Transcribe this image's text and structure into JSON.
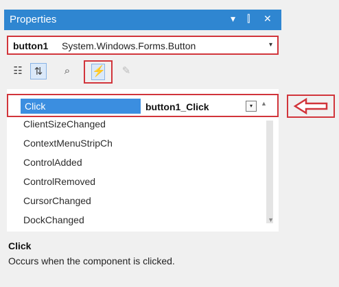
{
  "window": {
    "title": "Properties",
    "buttons": [
      "▾",
      "⫿",
      "✕"
    ]
  },
  "selector": {
    "name": "button1",
    "type": "System.Windows.Forms.Button",
    "arrow": "▾"
  },
  "toolbar": {
    "items": [
      {
        "icon": "categorized-icon",
        "glyph": "☷"
      },
      {
        "icon": "alphabetical-icon",
        "glyph": "⇅"
      },
      {
        "icon": "properties-icon",
        "glyph": "⌕"
      },
      {
        "icon": "events-lightning-icon",
        "glyph": "⚡"
      },
      {
        "icon": "property-pages-icon",
        "glyph": "✎"
      }
    ]
  },
  "events": {
    "selected": {
      "name": "Click",
      "handler": "button1_Click",
      "dropdown_glyph": "▾"
    },
    "items": [
      "ClientSizeChanged",
      "ContextMenuStripCh",
      "ControlAdded",
      "ControlRemoved",
      "CursorChanged",
      "DockChanged"
    ]
  },
  "description": {
    "title": "Click",
    "text": "Occurs when the component is clicked."
  },
  "colors": {
    "titlebar": "#2f86d1",
    "highlight": "#d1343a",
    "selection": "#3b8ee0"
  }
}
